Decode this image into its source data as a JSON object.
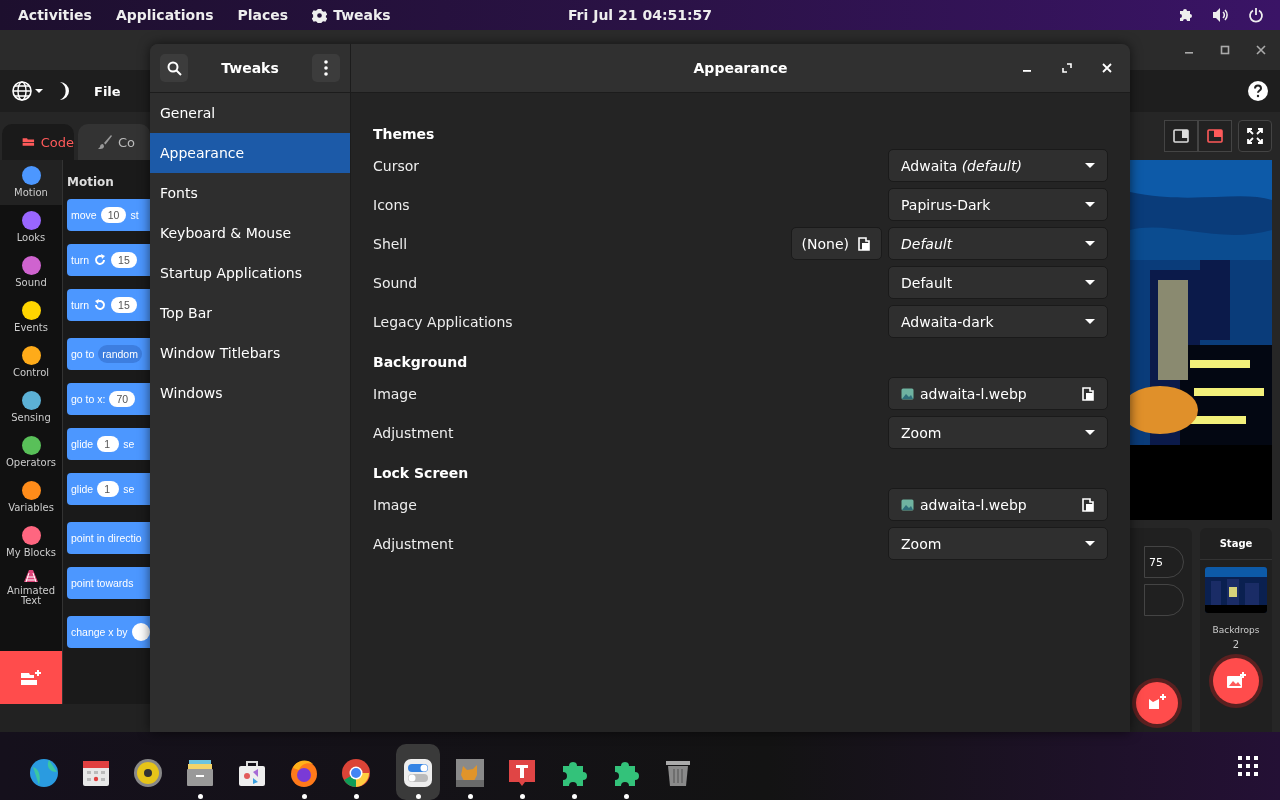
{
  "top_bar": {
    "activities": "Activities",
    "menus": [
      "Applications",
      "Places"
    ],
    "app_name": "Tweaks",
    "clock": "Fri Jul 21  04:51:57"
  },
  "scratch": {
    "menu_file": "File",
    "tabs": [
      {
        "label": "Code",
        "selected": true
      },
      {
        "label": "Co",
        "selected": false
      }
    ],
    "categories": [
      {
        "name": "Motion",
        "kind": "dot",
        "color": "#4c97ff",
        "selected": true
      },
      {
        "name": "Looks",
        "kind": "dot",
        "color": "#9966ff",
        "selected": false
      },
      {
        "name": "Sound",
        "kind": "dot",
        "color": "#cf63cf",
        "selected": false
      },
      {
        "name": "Events",
        "kind": "dot",
        "color": "#ffd500",
        "selected": false
      },
      {
        "name": "Control",
        "kind": "dot",
        "color": "#ffab19",
        "selected": false
      },
      {
        "name": "Sensing",
        "kind": "dot",
        "color": "#5cb1d6",
        "selected": false
      },
      {
        "name": "Operators",
        "kind": "dot",
        "color": "#59c059",
        "selected": false
      },
      {
        "name": "Variables",
        "kind": "dot",
        "color": "#ff8c1a",
        "selected": false
      },
      {
        "name": "My Blocks",
        "kind": "dot",
        "color": "#ff6680",
        "selected": false
      },
      {
        "name": "Animated Text",
        "kind": "extension",
        "selected": false
      }
    ],
    "palette_title": "Motion",
    "block_groups": [
      {
        "blocks": [
          {
            "parts": [
              {
                "kind": "text",
                "text": "move"
              },
              {
                "kind": "input",
                "text": "10"
              },
              {
                "kind": "text",
                "text": "st"
              }
            ]
          },
          {
            "parts": [
              {
                "kind": "text",
                "text": "turn"
              },
              {
                "kind": "rotate-cw"
              },
              {
                "kind": "input",
                "text": "15"
              }
            ]
          },
          {
            "parts": [
              {
                "kind": "text",
                "text": "turn"
              },
              {
                "kind": "rotate-ccw"
              },
              {
                "kind": "input",
                "text": "15"
              }
            ]
          }
        ]
      },
      {
        "blocks": [
          {
            "parts": [
              {
                "kind": "text",
                "text": "go to"
              },
              {
                "kind": "menu",
                "text": "random"
              }
            ]
          },
          {
            "parts": [
              {
                "kind": "text",
                "text": "go to x:"
              },
              {
                "kind": "input",
                "text": "70"
              }
            ]
          },
          {
            "parts": [
              {
                "kind": "text",
                "text": "glide"
              },
              {
                "kind": "input",
                "text": "1"
              },
              {
                "kind": "text",
                "text": "se"
              }
            ]
          },
          {
            "parts": [
              {
                "kind": "text",
                "text": "glide"
              },
              {
                "kind": "input",
                "text": "1"
              },
              {
                "kind": "text",
                "text": "se"
              }
            ]
          }
        ]
      },
      {
        "blocks": [
          {
            "parts": [
              {
                "kind": "text",
                "text": "point in directio"
              }
            ]
          },
          {
            "parts": [
              {
                "kind": "text",
                "text": "point towards"
              }
            ]
          }
        ]
      },
      {
        "blocks": [
          {
            "parts": [
              {
                "kind": "text",
                "text": "change x by"
              },
              {
                "kind": "input-cut"
              }
            ]
          }
        ]
      }
    ],
    "stage_modes": [
      {
        "kind": "small",
        "selected": false
      },
      {
        "kind": "normal",
        "selected": true
      }
    ],
    "sprite_field": "75",
    "stage_panel": {
      "title": "Stage",
      "backdrops_label": "Backdrops",
      "backdrops_count": "2"
    }
  },
  "tweaks": {
    "title": "Tweaks",
    "page_title": "Appearance",
    "sidebar": [
      {
        "label": "General",
        "selected": false
      },
      {
        "label": "Appearance",
        "selected": true
      },
      {
        "label": "Fonts",
        "selected": false
      },
      {
        "label": "Keyboard & Mouse",
        "selected": false
      },
      {
        "label": "Startup Applications",
        "selected": false
      },
      {
        "label": "Top Bar",
        "selected": false
      },
      {
        "label": "Window Titlebars",
        "selected": false
      },
      {
        "label": "Windows",
        "selected": false
      }
    ],
    "sections": [
      {
        "title": "Themes",
        "rows": [
          {
            "label": "Cursor",
            "kind": "dropdown",
            "value": "Adwaita *(default)*",
            "italic": false
          },
          {
            "label": "Icons",
            "kind": "dropdown",
            "value": "Papirus-Dark",
            "italic": false
          },
          {
            "label": "Shell",
            "kind": "dropdown",
            "value": "Default",
            "italic": true,
            "extra_button": "(None)"
          },
          {
            "label": "Sound",
            "kind": "dropdown",
            "value": "Default",
            "italic": false
          },
          {
            "label": "Legacy Applications",
            "kind": "dropdown",
            "value": "Adwaita-dark",
            "italic": false
          }
        ]
      },
      {
        "title": "Background",
        "rows": [
          {
            "label": "Image",
            "kind": "file",
            "value": "adwaita-l.webp",
            "italic": false
          },
          {
            "label": "Adjustment",
            "kind": "dropdown",
            "value": "Zoom",
            "italic": false
          }
        ]
      },
      {
        "title": "Lock Screen",
        "rows": [
          {
            "label": "Image",
            "kind": "file",
            "value": "adwaita-l.webp",
            "italic": false
          },
          {
            "label": "Adjustment",
            "kind": "dropdown",
            "value": "Zoom",
            "italic": false
          }
        ]
      }
    ]
  },
  "dock": [
    {
      "kind": "globe",
      "running": false,
      "selected": false
    },
    {
      "kind": "calendar",
      "running": false,
      "selected": false
    },
    {
      "kind": "speaker",
      "running": false,
      "selected": false
    },
    {
      "kind": "files",
      "running": true,
      "selected": false
    },
    {
      "kind": "software",
      "running": false,
      "selected": false
    },
    {
      "kind": "firefox",
      "running": true,
      "selected": false
    },
    {
      "kind": "chrome",
      "running": true,
      "selected": false
    },
    {
      "kind": "toggles",
      "running": true,
      "selected": true
    },
    {
      "kind": "scratch",
      "running": true,
      "selected": false
    },
    {
      "kind": "font",
      "running": true,
      "selected": false
    },
    {
      "kind": "puzzle",
      "running": true,
      "selected": false
    },
    {
      "kind": "puzzle",
      "running": true,
      "selected": false
    },
    {
      "kind": "trash",
      "running": false,
      "selected": false
    }
  ]
}
